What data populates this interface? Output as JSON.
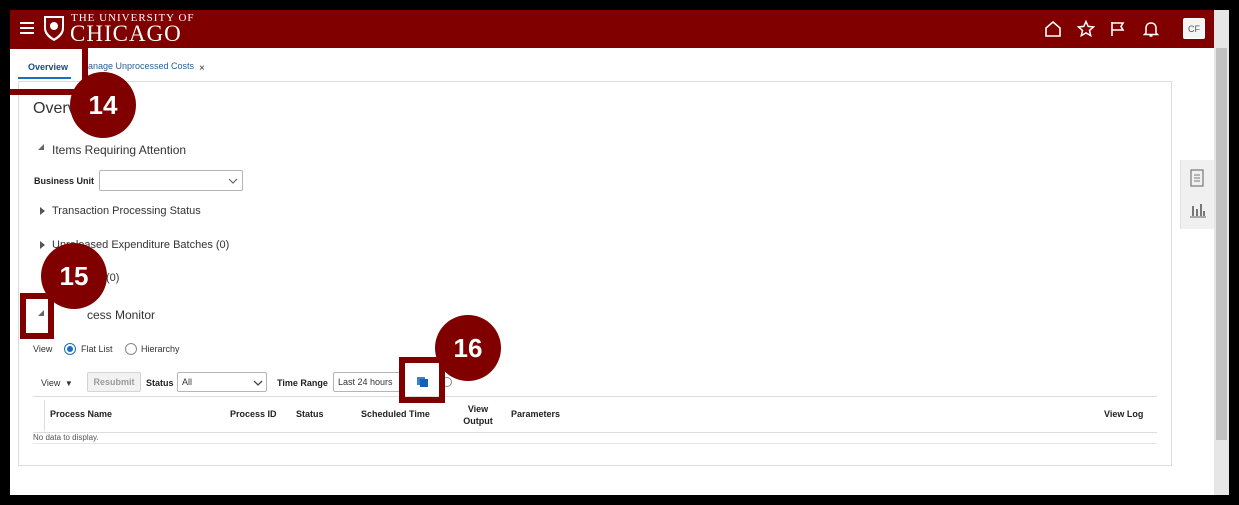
{
  "header": {
    "university_line1": "THE UNIVERSITY OF",
    "university_line2": "CHICAGO",
    "avatar_initials": "CF",
    "icons": [
      "menu-icon",
      "crest-logo",
      "home-icon",
      "star-icon",
      "flag-icon",
      "bell-icon"
    ]
  },
  "tabs": [
    {
      "label": "Overview"
    },
    {
      "label": "anage Unprocessed Costs"
    }
  ],
  "tab_close": "×",
  "page_title": "Overv",
  "items_requiring_attention": {
    "heading": "Items Requiring Attention",
    "business_unit_label": "Business Unit",
    "business_unit_value": "",
    "rows": [
      {
        "label": "Transaction Processing Status"
      },
      {
        "label": "Unreleased Expenditure Batches (0)"
      },
      {
        "label": "(0)"
      }
    ]
  },
  "process_monitor": {
    "heading": "cess Monitor",
    "view_label": "View",
    "view_options": [
      {
        "label": "Flat List",
        "selected": true
      },
      {
        "label": "Hierarchy",
        "selected": false
      }
    ],
    "toolbar": {
      "view_menu": "View",
      "resubmit": "Resubmit",
      "status_label": "Status",
      "status_value": "All",
      "time_range_label": "Time Range",
      "time_range_value": "Last 24 hours"
    },
    "table": {
      "columns": [
        "Process Name",
        "Process ID",
        "Status",
        "Scheduled Time",
        "View Output",
        "Parameters",
        "View Log"
      ],
      "empty_text": "No data to display."
    }
  },
  "annotations": {
    "badge_14": "14",
    "badge_15": "15",
    "badge_16": "16"
  },
  "colors": {
    "brand": "#800000",
    "link": "#1a4b8c"
  }
}
